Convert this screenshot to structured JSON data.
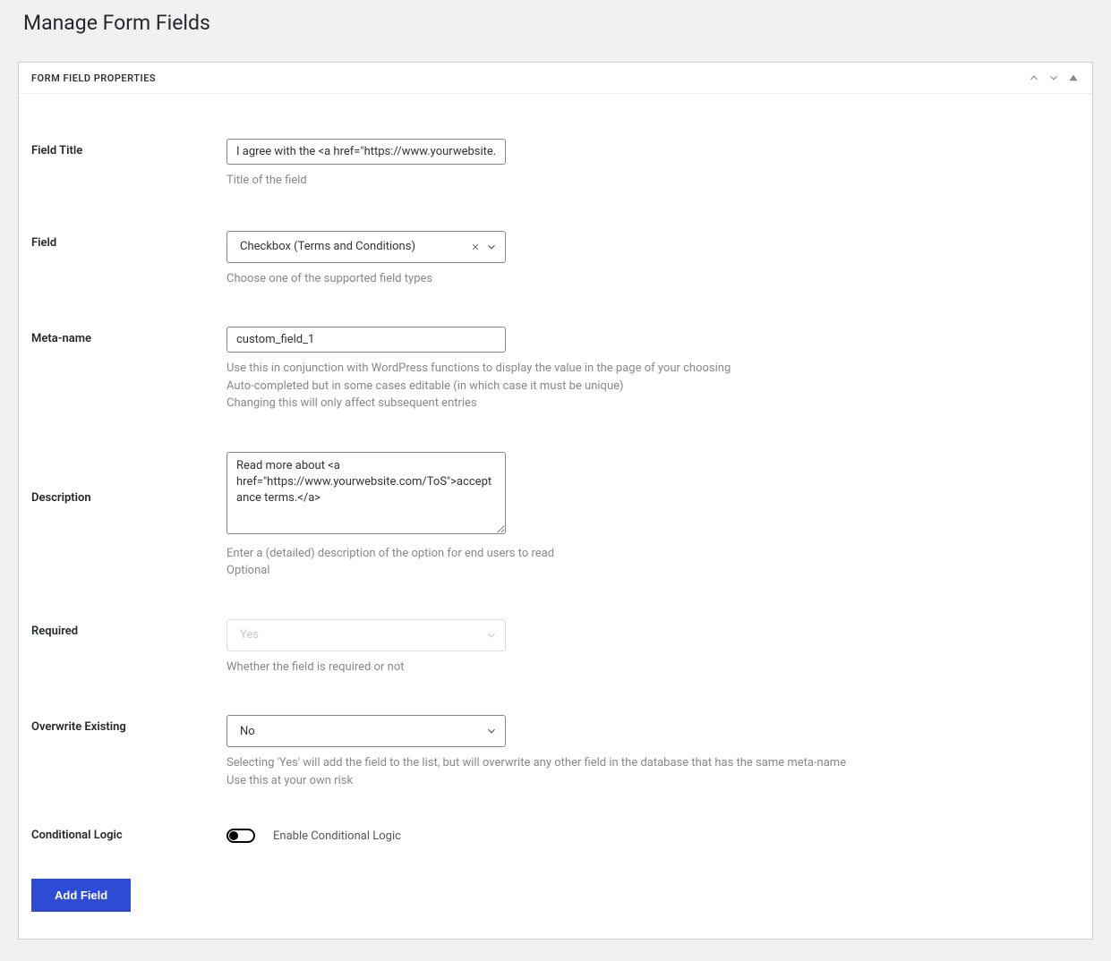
{
  "page_title": "Manage Form Fields",
  "panel": {
    "title": "FORM FIELD PROPERTIES"
  },
  "fields": {
    "field_title": {
      "label": "Field Title",
      "value": "I agree with the <a href=\"https://www.yourwebsite.co",
      "helper": "Title of the field"
    },
    "field_type": {
      "label": "Field",
      "value": "Checkbox (Terms and Conditions)",
      "helper": "Choose one of the supported field types"
    },
    "meta_name": {
      "label": "Meta-name",
      "value": "custom_field_1",
      "helper_1": "Use this in conjunction with WordPress functions to display the value in the page of your choosing",
      "helper_2": "Auto-completed but in some cases editable (in which case it must be unique)",
      "helper_3": "Changing this will only affect subsequent entries"
    },
    "description": {
      "label": "Description",
      "value": "Read more about <a href=\"https://www.yourwebsite.com/ToS\">acceptance terms.</a>",
      "helper_1": "Enter a (detailed) description of the option for end users to read",
      "helper_2": "Optional"
    },
    "required": {
      "label": "Required",
      "value": "Yes",
      "helper": "Whether the field is required or not"
    },
    "overwrite": {
      "label": "Overwrite Existing",
      "value": "No",
      "helper_1": "Selecting 'Yes' will add the field to the list, but will overwrite any other field in the database that has the same meta-name",
      "helper_2": "Use this at your own risk"
    },
    "conditional": {
      "label": "Conditional Logic",
      "toggle_label": "Enable Conditional Logic"
    }
  },
  "buttons": {
    "add_field": "Add Field"
  }
}
